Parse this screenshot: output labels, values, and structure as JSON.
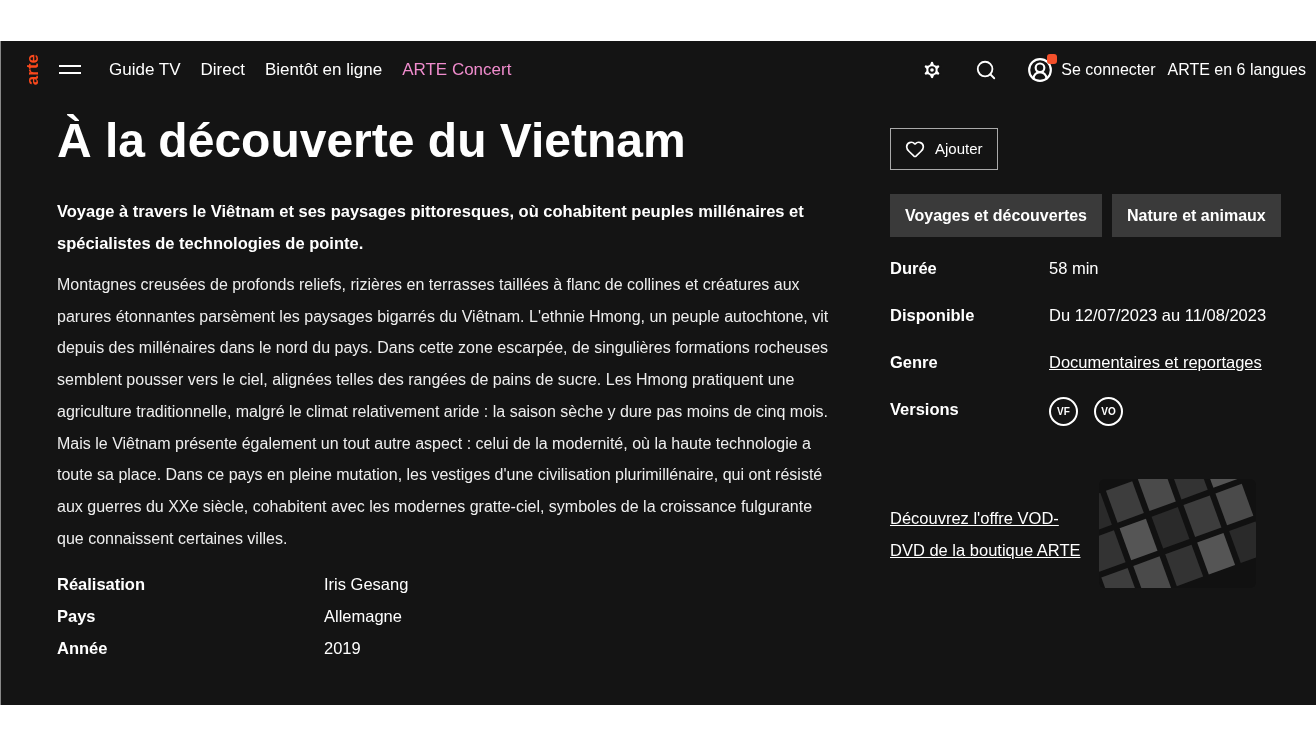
{
  "header": {
    "logo": "arte",
    "nav": [
      {
        "label": "Guide TV",
        "highlighted": false
      },
      {
        "label": "Direct",
        "highlighted": false
      },
      {
        "label": "Bientôt en ligne",
        "highlighted": false
      },
      {
        "label": "ARTE Concert",
        "highlighted": true
      }
    ],
    "login": "Se connecter",
    "notification": true,
    "languages": "ARTE en 6 langues"
  },
  "title": "À la découverte du Vietnam",
  "lede": "Voyage à travers le Viêtnam et ses paysages pittoresques, où cohabitent peuples millénaires et spécialistes de technologies de pointe.",
  "description": "Montagnes creusées de profonds reliefs, rizières en terrasses taillées à flanc de collines et créatures aux parures étonnantes parsèment les paysages bigarrés du Viêtnam. L'ethnie Hmong, un peuple autochtone, vit depuis des millénaires dans le nord du pays. Dans cette zone escarpée, de singulières formations rocheuses semblent pousser vers le ciel, alignées telles des rangées de pains de sucre. Les Hmong pratiquent une agriculture traditionnelle, malgré le climat relativement aride : la saison sèche y dure pas moins de cinq mois. Mais le Viêtnam présente également un tout autre aspect : celui de la modernité, où la haute technologie a toute sa place. Dans ce pays en pleine mutation, les vestiges d'une civilisation plurimillénaire, qui ont résisté aux guerres du XXe siècle, cohabitent avec les modernes gratte-ciel, symboles de la croissance fulgurante que connaissent certaines villes.",
  "credits": [
    {
      "label": "Réalisation",
      "value": "Iris Gesang"
    },
    {
      "label": "Pays",
      "value": "Allemagne"
    },
    {
      "label": "Année",
      "value": "2019"
    }
  ],
  "add_button": "Ajouter",
  "tags": [
    "Voyages et découvertes",
    "Nature et animaux"
  ],
  "info": [
    {
      "label": "Durée",
      "value": "58 min",
      "kind": "text"
    },
    {
      "label": "Disponible",
      "value": "Du 12/07/2023 au 11/08/2023",
      "kind": "text"
    },
    {
      "label": "Genre",
      "value": "Documentaires et reportages",
      "kind": "link"
    },
    {
      "label": "Versions",
      "versions": [
        "VF",
        "VO"
      ],
      "kind": "badges"
    }
  ],
  "promo": {
    "link": "Découvrez l'offre VOD-DVD de la boutique ARTE"
  }
}
